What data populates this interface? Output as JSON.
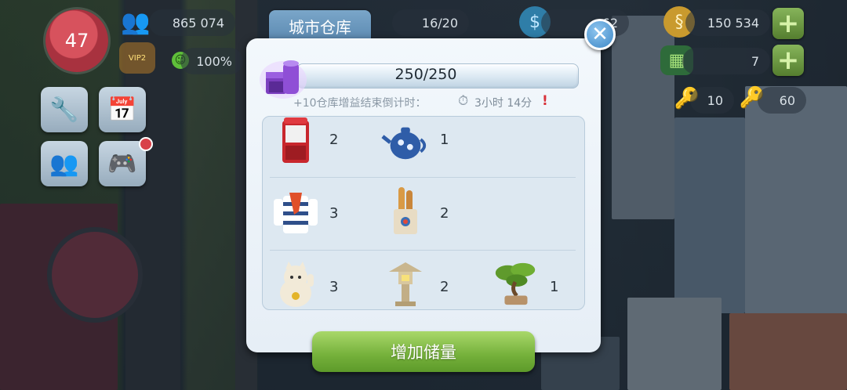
{
  "hud": {
    "level": "47",
    "population": "865 074",
    "happiness": "100%",
    "vip_label": "VIP2",
    "storage_capacity": "16/20",
    "simcash": "62",
    "simoleons": "150 534",
    "golden_keys": "7",
    "keys_a": "10",
    "keys_b": "60"
  },
  "dialog": {
    "tab_title": "城市仓库",
    "capacity_text": "250/250",
    "capacity_fill_fraction": 1.0,
    "boost_countdown_label": "+10仓库增益结束倒计时：",
    "boost_time": "3小时 14分",
    "items": [
      {
        "name": "phone-booth",
        "count": "2"
      },
      {
        "name": "teapot",
        "count": "1"
      },
      {
        "name": "striped-sweater",
        "count": "3"
      },
      {
        "name": "baguette-bag",
        "count": "2"
      },
      {
        "name": "lucky-cat",
        "count": "3"
      },
      {
        "name": "stone-lantern",
        "count": "2"
      },
      {
        "name": "bonsai-tree",
        "count": "1"
      }
    ],
    "cta_label": "增加储量",
    "close_icon": "close-icon"
  },
  "colors": {
    "cta_green": "#74b03a",
    "tab_blue": "#5b89b1",
    "level_red": "#a8323f"
  }
}
